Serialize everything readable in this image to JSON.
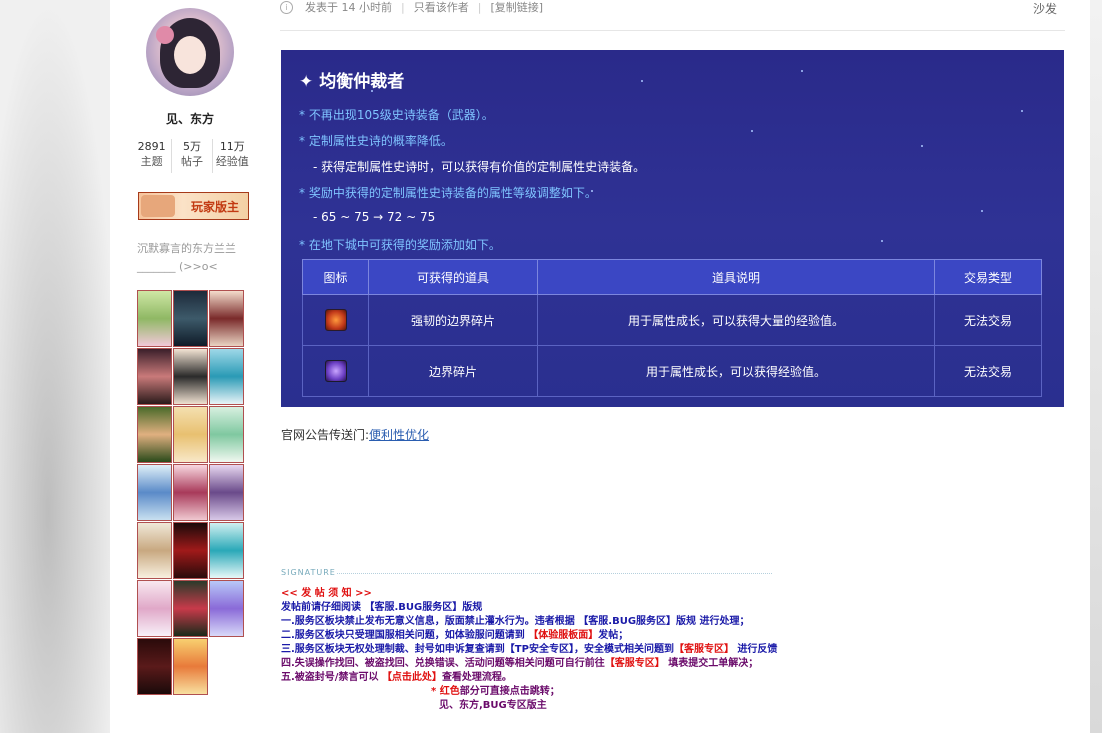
{
  "post_meta": {
    "posted": "发表于 14 小时前",
    "author_only": "只看该作者",
    "copy_link": "[复制链接]",
    "floor": "沙发"
  },
  "author": {
    "name": "见、东方",
    "stats": [
      {
        "value": "2891",
        "label": "主题"
      },
      {
        "value": "5万",
        "label": "帖子"
      },
      {
        "value": "11万",
        "label": "经验值"
      }
    ],
    "badge": "玩家版主",
    "signature_line1": "沉默寡言的东方兰兰",
    "signature_line2": "_______ (>>o<"
  },
  "notice": {
    "title": "均衡仲裁者",
    "lines": [
      "* 不再出现105级史诗装备（武器）。",
      "* 定制属性史诗的概率降低。",
      "- 获得定制属性史诗时，可以获得有价值的定制属性史诗装备。",
      "* 奖励中获得的定制属性史诗装备的属性等级调整如下。",
      "- 65 ~ 75 → 72 ~ 75",
      "* 在地下城中可获得的奖励添加如下。"
    ],
    "table_headers": [
      "图标",
      "可获得的道具",
      "道具说明",
      "交易类型"
    ],
    "rows": [
      {
        "icon": "tough-boundary-fragment-icon",
        "name": "强韧的边界碎片",
        "desc": "用于属性成长，可以获得大量的经验值。",
        "trade": "无法交易"
      },
      {
        "icon": "boundary-fragment-icon",
        "name": "边界碎片",
        "desc": "用于属性成长，可以获得经验值。",
        "trade": "无法交易"
      }
    ]
  },
  "portal": {
    "prefix": "官网公告传送门:",
    "link": "便利性优化"
  },
  "signature": {
    "label": "SIGNATURE",
    "heading": "<< 发 帖 须 知 >>",
    "intro": "发帖前请仔细阅读 【客服.BUG服务区】版规",
    "l1a": "一.服务区板块禁止发布无意义信息，版面禁止灌水行为。违者根据 【客服.BUG服务区】版规 进行处理；",
    "l2a": "二.服务区板块只受理国服相关问题，如体验服问题请到 ",
    "l2r": "【体验服板面】",
    "l2b": "发帖；",
    "l3a": "三.服务区板块无权处理制裁、封号如申诉复查请到【TP安全专区】，安全模式相关问题到",
    "l3r": "【客服专区】",
    "l3b": " 进行反馈",
    "l4a": "四.失误操作找回、被盗找回、兑换错误、活动问题等相关问题可自行前往",
    "l4r": "【客服专区】",
    "l4b": " 填表提交工单解决；",
    "l5a": "五.被盗封号/禁言可以 ",
    "l5r": "【点击此处】",
    "l5b": "查看处理流程。",
    "note_r": "* 红色",
    "note_b": "部分可直接点击跳转；",
    "footer": "见、东方,BUG专区版主"
  },
  "colors": {
    "notice_bg": "#2c2f90",
    "notice_text": "#7fc4ff",
    "table_header": "#3b47c4",
    "signature_red": "#e01010",
    "signature_blue": "#1a1aa8"
  }
}
